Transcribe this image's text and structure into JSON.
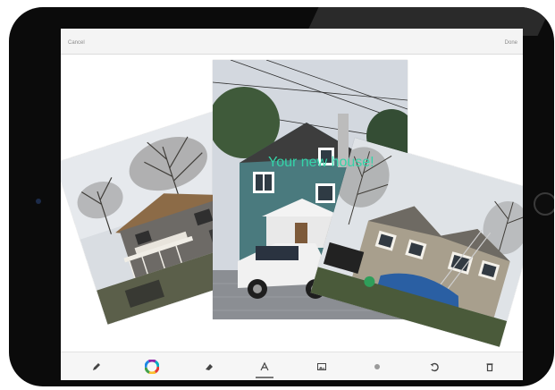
{
  "nav": {
    "cancel_label": "Cancel",
    "done_label": "Done"
  },
  "canvas": {
    "caption_text": "Your new house!",
    "caption_color": "#35d4a8",
    "photos": [
      "house-photo-left",
      "house-photo-center",
      "house-photo-right"
    ]
  },
  "toolbar": {
    "tools": [
      "pen-icon",
      "color-wheel-icon",
      "eraser-icon",
      "text-icon",
      "image-icon",
      "sticker-icon",
      "undo-icon",
      "trash-icon"
    ],
    "selected_tool": "text-icon"
  }
}
